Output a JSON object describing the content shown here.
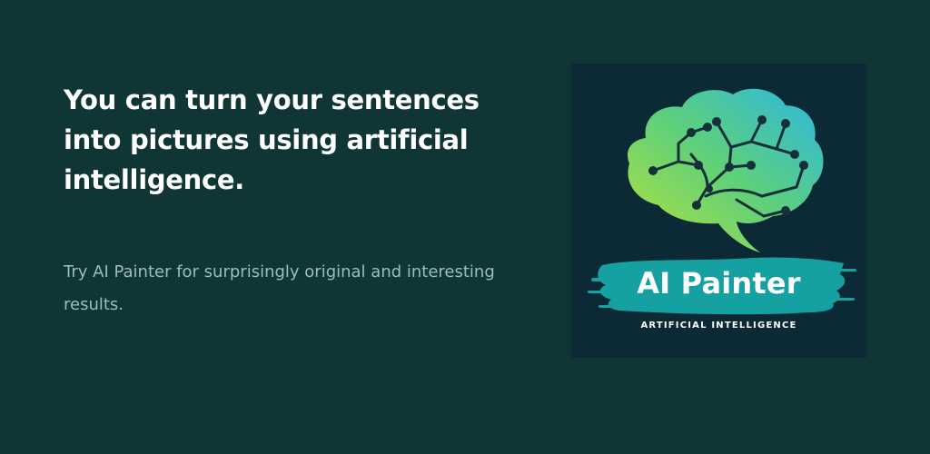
{
  "hero": {
    "headline": "You can turn your sentences into pictures using artificial intelligence.",
    "subtext": "Try AI Painter for surprisingly original and interesting results."
  },
  "logo": {
    "name": "AI Painter",
    "tagline": "ARTIFICIAL INTELLIGENCE",
    "icon": "brain-circuit-icon"
  },
  "colors": {
    "background": "#0f3535",
    "card_background": "#0b2a35",
    "brush_stroke": "#15a0a2",
    "brain_gradient_start": "#b7e23c",
    "brain_gradient_end": "#2bb7e2",
    "headline_text": "#ffffff",
    "subtext": "#9fbcbd"
  }
}
